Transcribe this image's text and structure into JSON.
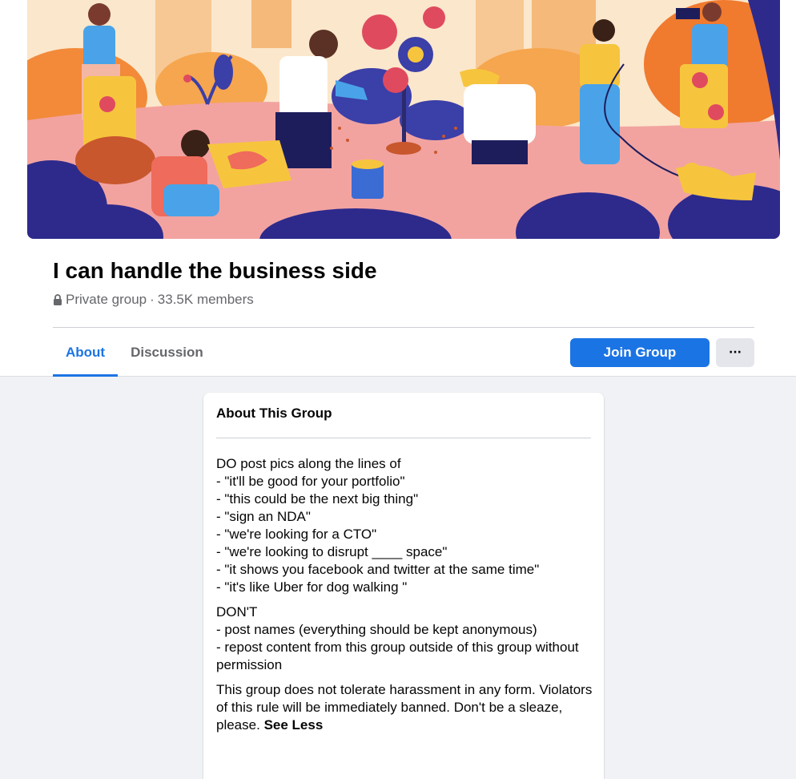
{
  "group": {
    "name": "I can handle the business side",
    "privacy": "Private group",
    "separator": "·",
    "members": "33.5K members"
  },
  "tabs": [
    {
      "label": "About",
      "active": true
    },
    {
      "label": "Discussion",
      "active": false
    }
  ],
  "actions": {
    "join_label": "Join Group",
    "more_label": "···"
  },
  "about": {
    "title": "About This Group",
    "paragraph1": [
      "DO post pics along the lines of",
      "- \"it'll be good for your portfolio\"",
      "- \"this could be the next big thing\"",
      "- \"sign an NDA\"",
      "- \"we're looking for a CTO\"",
      "- \"we're looking to disrupt ____ space\"",
      "- \"it shows you facebook and twitter at the same time\"",
      "- \"it's like Uber for dog walking \""
    ],
    "paragraph2": [
      "DON'T",
      "- post names (everything should be kept anonymous)",
      "- repost content from this group outside of this group without permission"
    ],
    "paragraph3": "This group does not tolerate harassment in any form. Violators of this rule will be immediately banned. Don't be a sleaze, please.",
    "see_less": "See Less"
  },
  "colors": {
    "accent": "#1b74e4",
    "background": "#f0f2f5",
    "cover_sky": "#f9e3c4",
    "cover_ground": "#f2a3a0",
    "cover_foliage": "#2d2a8c"
  },
  "icons": {
    "lock": "lock-icon",
    "more": "more-icon"
  }
}
